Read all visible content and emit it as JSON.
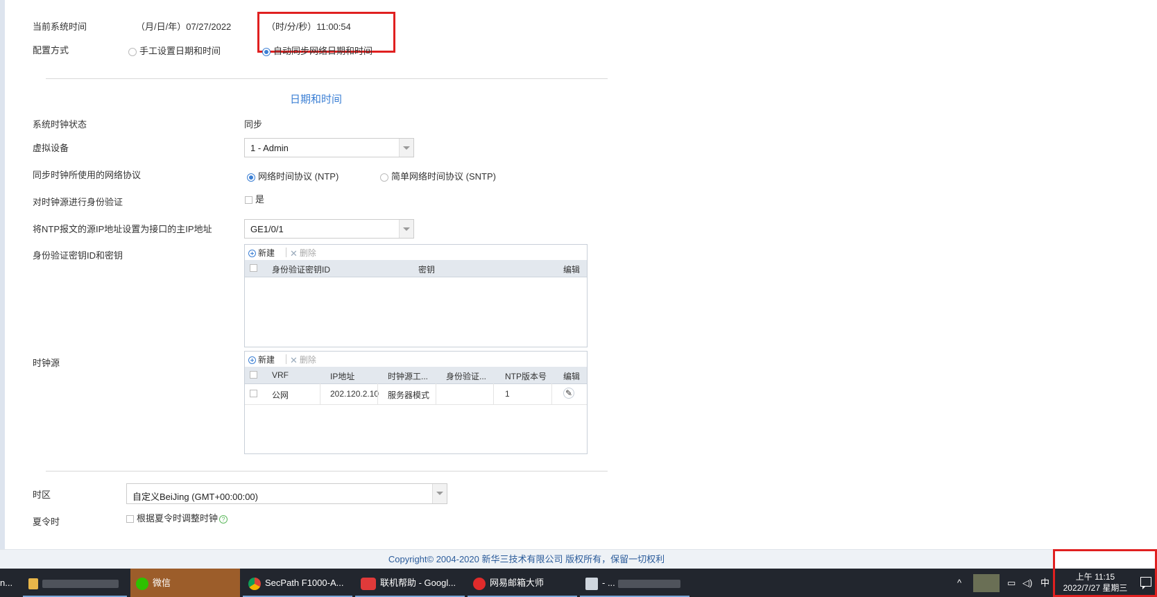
{
  "top": {
    "current_time_label": "当前系统时间",
    "date_text": "（月/日/年）07/27/2022",
    "time_text": "（时/分/秒）11:00:54",
    "config_label": "配置方式",
    "config_options": [
      "手工设置日期和时间",
      "自动同步网络日期和时间"
    ]
  },
  "section": {
    "title": "日期和时间"
  },
  "form": {
    "clock_status_label": "系统时钟状态",
    "clock_status_value": "同步",
    "vdevice_label": "虚拟设备",
    "vdevice_value": "1 - Admin",
    "protocol_label": "同步时钟所使用的网络协议",
    "protocol_options": [
      "网络时间协议 (NTP)",
      "简单网络时间协议 (SNTP)"
    ],
    "auth_label": "对时钟源进行身份验证",
    "auth_checkbox_label": "是",
    "source_ip_label": "将NTP报文的源IP地址设置为接口的主IP地址",
    "source_ip_value": "GE1/0/1",
    "keys_label": "身份验证密钥ID和密钥",
    "clock_source_label": "时钟源"
  },
  "keys_grid": {
    "new_label": "新建",
    "delete_label": "删除",
    "columns": [
      "身份验证密钥ID",
      "密钥",
      "编辑"
    ]
  },
  "source_grid": {
    "new_label": "新建",
    "delete_label": "删除",
    "columns": [
      "VRF",
      "IP地址",
      "时钟源工...",
      "身份验证...",
      "NTP版本号",
      "编辑"
    ],
    "rows": [
      {
        "vrf": "公网",
        "ip": "202.120.2.10",
        "mode": "服务器模式",
        "auth": "",
        "ntp_version": "1"
      }
    ]
  },
  "timezone": {
    "label": "时区",
    "value": "自定义BeiJing (GMT+00:00:00)",
    "dst_label": "夏令时",
    "dst_checkbox_label": "根据夏令时调整时钟"
  },
  "footer": {
    "copyright": "Copyright© 2004-2020 新华三技术有限公司 版权所有，保留一切权利"
  },
  "taskbar": {
    "items": [
      {
        "label": "n..."
      },
      {
        "label": ""
      },
      {
        "label": "微信"
      },
      {
        "label": "SecPath F1000-A..."
      },
      {
        "label": "联机帮助 - Googl..."
      },
      {
        "label": "网易邮箱大师"
      },
      {
        "label": "- ..."
      }
    ],
    "ime": "中",
    "clock_time": "上午 11:15",
    "clock_date": "2022/7/27 星期三"
  },
  "colors": {
    "accent": "#3b7fd4",
    "highlight_box": "#e02020",
    "taskbar": "#22262e",
    "wechat_active": "#9c5d2a"
  }
}
